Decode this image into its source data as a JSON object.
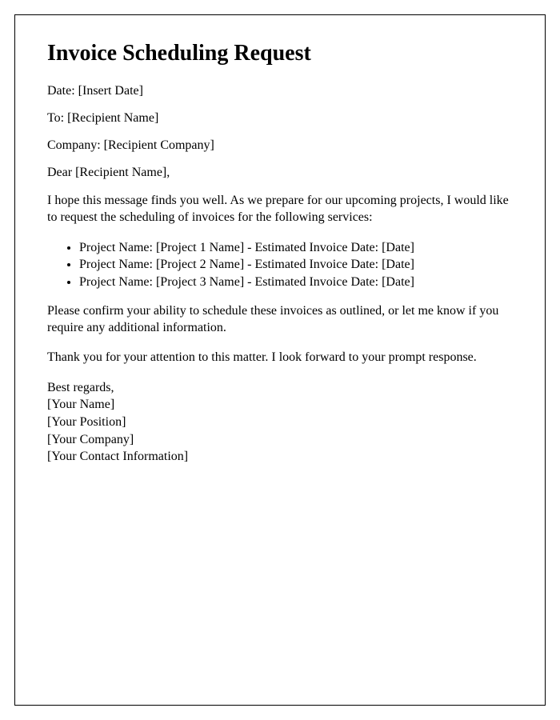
{
  "title": "Invoice Scheduling Request",
  "fields": {
    "date_label": "Date: ",
    "date_value": "[Insert Date]",
    "to_label": "To: ",
    "to_value": "[Recipient Name]",
    "company_label": "Company: ",
    "company_value": "[Recipient Company]"
  },
  "salutation": "Dear [Recipient Name],",
  "intro": "I hope this message finds you well. As we prepare for our upcoming projects, I would like to request the scheduling of invoices for the following services:",
  "projects": [
    "Project Name: [Project 1 Name] - Estimated Invoice Date: [Date]",
    "Project Name: [Project 2 Name] - Estimated Invoice Date: [Date]",
    "Project Name: [Project 3 Name] - Estimated Invoice Date: [Date]"
  ],
  "confirm": "Please confirm your ability to schedule these invoices as outlined, or let me know if you require any additional information.",
  "thanks": "Thank you for your attention to this matter. I look forward to your prompt response.",
  "closing": {
    "regards": "Best regards,",
    "name": "[Your Name]",
    "position": "[Your Position]",
    "company": "[Your Company]",
    "contact": "[Your Contact Information]"
  }
}
